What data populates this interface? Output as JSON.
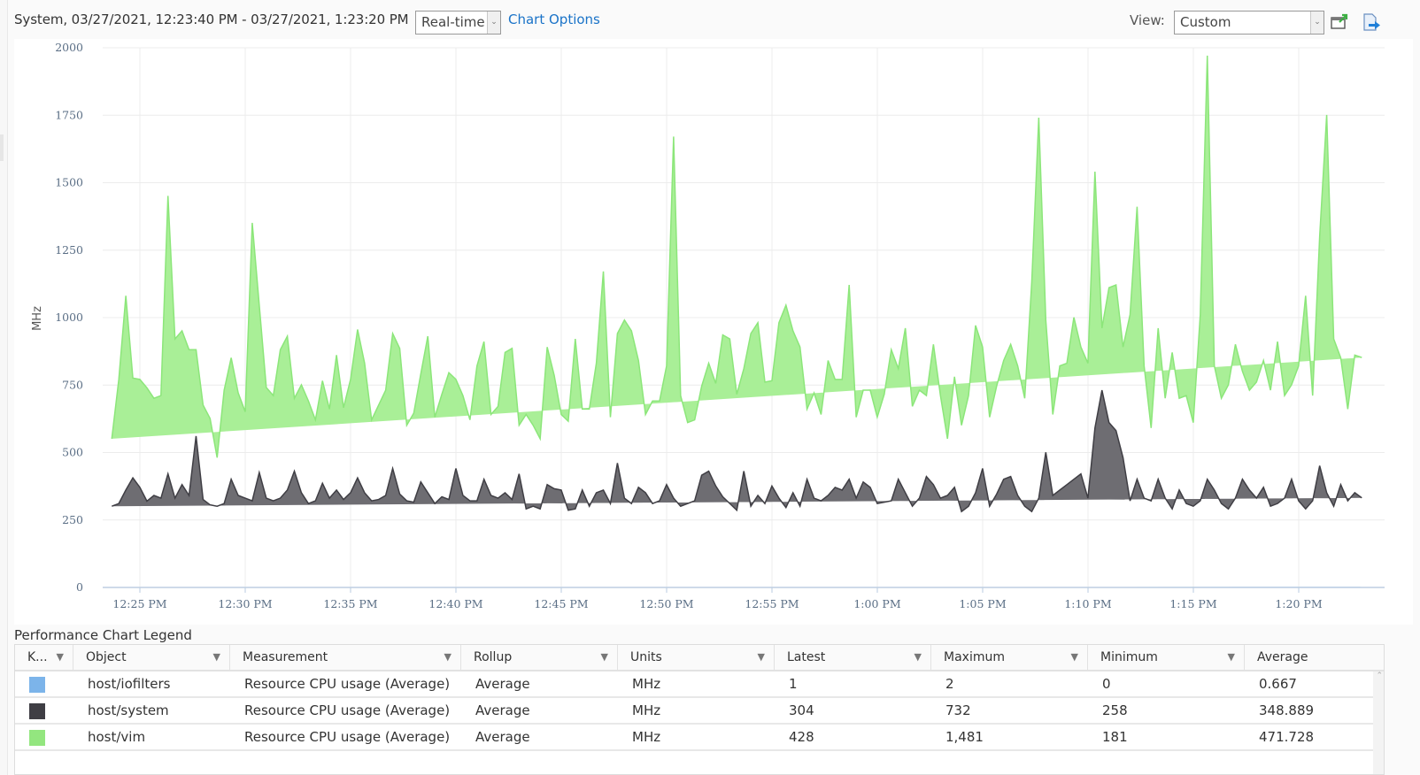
{
  "header": {
    "title": "System, 03/27/2021, 12:23:40 PM - 03/27/2021, 1:23:20 PM",
    "timespan_select": "Real-time",
    "chart_options_link": "Chart Options",
    "view_label": "View:",
    "view_select": "Custom",
    "icons": [
      "popout-chart-icon",
      "export-icon"
    ]
  },
  "colors": {
    "system": "#6e6d72",
    "system_line": "#3f3e44",
    "vim": "#a9ef97",
    "vim_line": "#8ce67a",
    "iofilters": "#7cb4ea",
    "link": "#1a73c8",
    "axis_text": "#5a6e85"
  },
  "chart_data": {
    "type": "area",
    "stacked": true,
    "title": "",
    "xlabel": "",
    "ylabel": "MHz",
    "ylim": [
      0,
      2000
    ],
    "yticks": [
      0,
      250,
      500,
      750,
      1000,
      1250,
      1500,
      1750,
      2000
    ],
    "ytick_labels": [
      "0",
      "250",
      "500",
      "750",
      "1000",
      "1250",
      "1500",
      "1750",
      "2000"
    ],
    "x_start_minutes": -1.333,
    "x_interval_minutes": 0.3333,
    "x_ticks_minutes": [
      0,
      5,
      10,
      15,
      20,
      25,
      30,
      35,
      40,
      45,
      50,
      55
    ],
    "x_tick_labels": [
      "12:25 PM",
      "12:30 PM",
      "12:35 PM",
      "12:40 PM",
      "12:45 PM",
      "12:50 PM",
      "12:55 PM",
      "1:00 PM",
      "1:05 PM",
      "1:10 PM",
      "1:15 PM",
      "1:20 PM"
    ],
    "grid": true,
    "legend": "bottom-table",
    "series": [
      {
        "name": "host/iofilters",
        "values_note": "near-zero (0–2 MHz)",
        "values": [
          1,
          1,
          1,
          1,
          1,
          0,
          1,
          1,
          1,
          1,
          1,
          1,
          1,
          1,
          1,
          1,
          1,
          1,
          1,
          1,
          1,
          1,
          1,
          1,
          1,
          1,
          1,
          1,
          1,
          1,
          1,
          1,
          1,
          1,
          1,
          1,
          1,
          1,
          1,
          1,
          1,
          1,
          1,
          1,
          1,
          1,
          1,
          1,
          1,
          1,
          1,
          1,
          1,
          1,
          1,
          1,
          1,
          1,
          1,
          1,
          1,
          1,
          1,
          1,
          1,
          1,
          1,
          1,
          1,
          1,
          1,
          1,
          1,
          1,
          1,
          1,
          1,
          1,
          1,
          1,
          1,
          1,
          1,
          1,
          1,
          1,
          1,
          1,
          1,
          1,
          1,
          1,
          1,
          1,
          1,
          1,
          1,
          1,
          1,
          1,
          1,
          1,
          1,
          1,
          1,
          1,
          1,
          1,
          1,
          1,
          1,
          1,
          1,
          1,
          1,
          1,
          1,
          1,
          1,
          1,
          1,
          1,
          1,
          1,
          1,
          1,
          1,
          1,
          1,
          1,
          1,
          1,
          1,
          1,
          1,
          1,
          1,
          1,
          1,
          1,
          1,
          1,
          1,
          1,
          1,
          1,
          1,
          1,
          1,
          1,
          1,
          1,
          1,
          1,
          1,
          1,
          1,
          1,
          1,
          1,
          1,
          1,
          1,
          1,
          1,
          1,
          1,
          1,
          1,
          1,
          1,
          1,
          1,
          1,
          1,
          1,
          1,
          1,
          2
        ]
      },
      {
        "name": "host/system",
        "values": [
          300,
          310,
          360,
          405,
          370,
          320,
          340,
          330,
          420,
          330,
          380,
          340,
          560,
          325,
          305,
          300,
          310,
          400,
          340,
          330,
          320,
          425,
          330,
          320,
          330,
          360,
          430,
          350,
          310,
          320,
          385,
          330,
          360,
          325,
          350,
          405,
          350,
          320,
          325,
          340,
          440,
          345,
          320,
          315,
          390,
          350,
          310,
          335,
          325,
          440,
          340,
          320,
          320,
          400,
          340,
          330,
          350,
          325,
          420,
          290,
          300,
          290,
          380,
          365,
          360,
          285,
          290,
          360,
          300,
          350,
          360,
          310,
          460,
          330,
          310,
          370,
          350,
          310,
          320,
          380,
          330,
          300,
          310,
          320,
          415,
          430,
          375,
          335,
          310,
          285,
          430,
          300,
          340,
          310,
          375,
          330,
          295,
          350,
          300,
          400,
          330,
          320,
          340,
          370,
          360,
          400,
          330,
          390,
          370,
          310,
          315,
          320,
          400,
          350,
          300,
          330,
          410,
          380,
          330,
          340,
          370,
          280,
          300,
          350,
          440,
          300,
          345,
          400,
          410,
          340,
          300,
          280,
          330,
          500,
          340,
          360,
          380,
          400,
          420,
          330,
          590,
          730,
          610,
          580,
          480,
          320,
          400,
          330,
          320,
          400,
          330,
          290,
          360,
          310,
          300,
          320,
          400,
          360,
          310,
          290,
          330,
          400,
          360,
          330,
          370,
          300,
          310,
          330,
          400,
          320,
          290,
          320,
          450,
          350,
          300,
          380,
          320,
          350,
          330,
          400,
          310,
          300,
          320,
          360,
          400,
          320,
          310,
          300,
          340,
          400,
          310,
          320,
          320,
          360,
          420,
          330,
          304
        ]
      },
      {
        "name": "host/vim",
        "values": [
          250,
          460,
          720,
          370,
          400,
          420,
          360,
          380,
          1030,
          590,
          570,
          540,
          320,
          350,
          320,
          180,
          420,
          450,
          380,
          320,
          1030,
          620,
          410,
          390,
          550,
          570,
          270,
          400,
          380,
          300,
          380,
          330,
          500,
          340,
          420,
          550,
          480,
          300,
          350,
          390,
          500,
          540,
          280,
          330,
          400,
          580,
          320,
          380,
          470,
          330,
          370,
          300,
          500,
          510,
          300,
          340,
          520,
          560,
          180,
          350,
          300,
          260,
          510,
          420,
          280,
          330,
          630,
          300,
          360,
          480,
          810,
          320,
          480,
          660,
          640,
          470,
          290,
          380,
          370,
          440,
          1340,
          410,
          300,
          300,
          330,
          400,
          380,
          600,
          610,
          430,
          380,
          640,
          640,
          450,
          390,
          650,
          750,
          600,
          590,
          260,
          390,
          320,
          500,
          400,
          410,
          720,
          300,
          340,
          360,
          320,
          400,
          560,
          410,
          610,
          370,
          400,
          300,
          520,
          380,
          210,
          410,
          320,
          410,
          620,
          450,
          330,
          400,
          440,
          490,
          480,
          400,
          850,
          1410,
          490,
          300,
          460,
          450,
          600,
          470,
          500,
          950,
          230,
          500,
          540,
          410,
          690,
          1010,
          490,
          270,
          560,
          370,
          580,
          340,
          400,
          310,
          690,
          1570,
          460,
          390,
          460,
          570,
          400,
          370,
          430,
          470,
          430,
          600,
          380,
          350,
          500,
          790,
          390,
          850,
          1400,
          620,
          470,
          340,
          510,
          520,
          460,
          370,
          460,
          660,
          510,
          490,
          520,
          640,
          690,
          410,
          610,
          600,
          490,
          420,
          380,
          430
        ]
      }
    ]
  },
  "legend": {
    "title": "Performance Chart Legend",
    "columns": [
      "K...",
      "Object",
      "Measurement",
      "Rollup",
      "Units",
      "Latest",
      "Maximum",
      "Minimum",
      "Average"
    ],
    "rows": [
      {
        "key_color": "#7cb4ea",
        "object": "host/iofilters",
        "measurement": "Resource CPU usage (Average)",
        "rollup": "Average",
        "units": "MHz",
        "latest": "1",
        "maximum": "2",
        "minimum": "0",
        "average": "0.667"
      },
      {
        "key_color": "#3f3e44",
        "object": "host/system",
        "measurement": "Resource CPU usage (Average)",
        "rollup": "Average",
        "units": "MHz",
        "latest": "304",
        "maximum": "732",
        "minimum": "258",
        "average": "348.889"
      },
      {
        "key_color": "#93e67f",
        "object": "host/vim",
        "measurement": "Resource CPU usage (Average)",
        "rollup": "Average",
        "units": "MHz",
        "latest": "428",
        "maximum": "1,481",
        "minimum": "181",
        "average": "471.728"
      }
    ]
  }
}
